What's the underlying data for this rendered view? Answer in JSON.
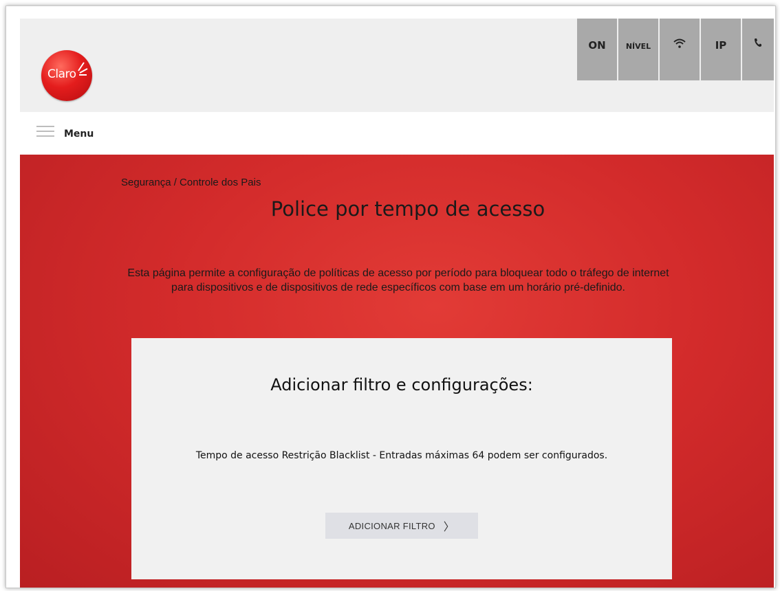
{
  "brand": {
    "logo_text": "Claro",
    "accent_color": "#d32b2b"
  },
  "status_bar": [
    {
      "id": "on",
      "label": "ON"
    },
    {
      "id": "nivel",
      "label": "NÍVEL"
    },
    {
      "id": "wifi",
      "icon": "wifi-icon"
    },
    {
      "id": "ip",
      "label": "IP"
    },
    {
      "id": "phone",
      "icon": "phone-icon"
    }
  ],
  "menu": {
    "label": "Menu",
    "icon": "hamburger-icon"
  },
  "breadcrumb": "Segurança / Controle dos Pais",
  "page_title": "Police por tempo de acesso",
  "description": "Esta página permite a configuração de políticas de acesso por período para bloquear todo o tráfego de internet para dispositivos e de dispositivos de rede específicos com base em um horário pré-definido.",
  "card": {
    "title": "Adicionar filtro e configurações:",
    "text": "Tempo de acesso Restrição Blacklist - Entradas máximas 64 podem ser configurados.",
    "button_label": "ADICIONAR FILTRO",
    "button_icon": "chevron-right-icon"
  }
}
